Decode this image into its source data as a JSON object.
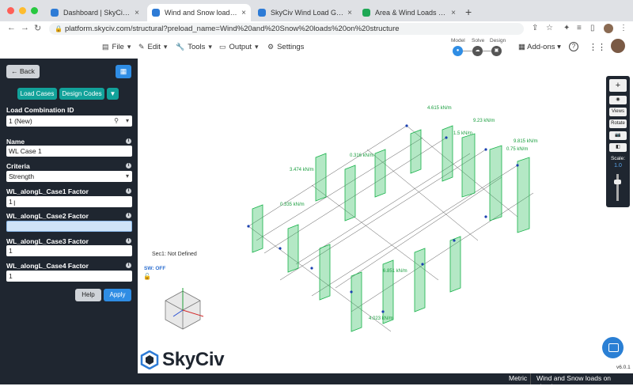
{
  "browser": {
    "tabs": [
      {
        "label": "Dashboard | SkyCiv Platform",
        "active": false
      },
      {
        "label": "Wind and Snow loads on struc",
        "active": true
      },
      {
        "label": "SkyCiv Wind Load Generator |",
        "active": false
      },
      {
        "label": "Area & Wind Loads | SkyCiv En",
        "active": false
      }
    ],
    "url": "platform.skyciv.com/structural?preload_name=Wind%20and%20Snow%20loads%20on%20structure"
  },
  "toolbar": {
    "file": "File",
    "edit": "Edit",
    "tools": "Tools",
    "output": "Output",
    "settings": "Settings",
    "steps": [
      "Model",
      "Solve",
      "Design"
    ],
    "addons": "Add-ons"
  },
  "panel": {
    "back_label": "Back",
    "load_cases_label": "Load Cases",
    "design_codes_label": "Design Codes",
    "load_combination_id_label": "Load Combination ID",
    "load_combination_id_value": "1 (New)",
    "name_label": "Name",
    "name_value": "WL Case 1",
    "criteria_label": "Criteria",
    "criteria_value": "Strength",
    "factor1_label": "WL_alongL_Case1 Factor",
    "factor1_value": "1",
    "factor2_label": "WL_alongL_Case2 Factor",
    "factor2_value": "",
    "factor3_label": "WL_alongL_Case3 Factor",
    "factor3_value": "1",
    "factor4_label": "WL_alongL_Case4 Factor",
    "factor4_value": "1",
    "help_label": "Help",
    "apply_label": "Apply"
  },
  "canvas": {
    "section_text": "Sec1: Not Defined",
    "sw_text": "SW: OFF",
    "labels": [
      "4.615 kN/m",
      "9.23 kN/m",
      "1.5 kN/m",
      "0.75 kN/m",
      "3.474 kN/m",
      "0.316 kN/m",
      "0.335 kN/m",
      "6.851 kN/m",
      "4.023 kN/m",
      "9.815 kN/m"
    ],
    "tools": {
      "views": "Views",
      "rotate": "Rotate",
      "scale_label": "Scale:",
      "scale_value": "1.0"
    }
  },
  "logo": "SkyCiv",
  "version": "v6.0.1",
  "status": {
    "units": "Metric",
    "title": "Wind and Snow loads on structure"
  }
}
